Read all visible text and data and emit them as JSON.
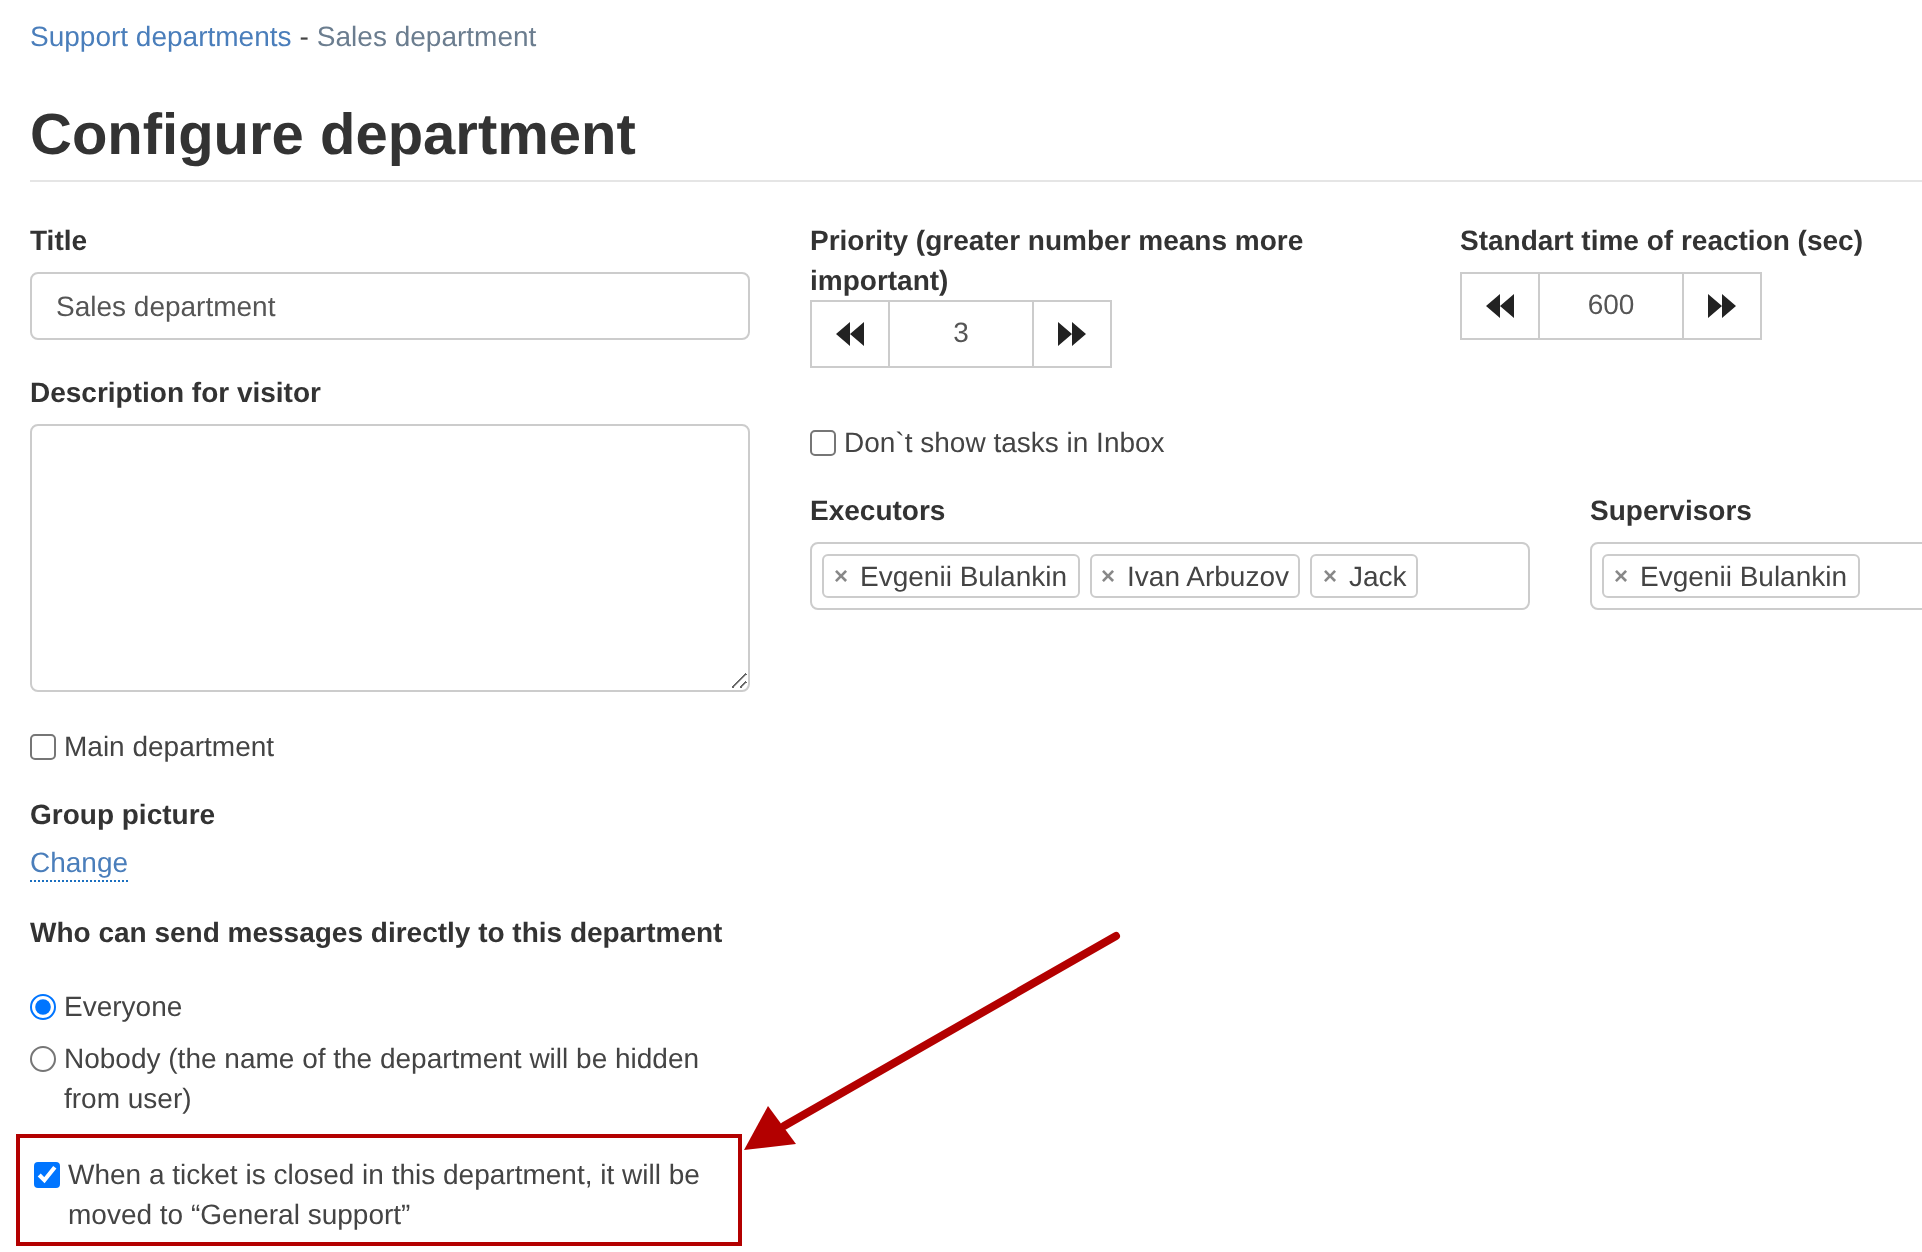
{
  "breadcrumb": [
    {
      "label": "Support departments",
      "kind": "link"
    },
    {
      "label": "-",
      "kind": "separator"
    },
    {
      "label": "Sales department",
      "kind": "current"
    }
  ],
  "heading": "Configure department",
  "title_field": {
    "label": "Title",
    "value": "Sales department"
  },
  "description_field": {
    "label": "Description for visitor"
  },
  "main_department": {
    "label": "Main department",
    "checked": false
  },
  "group_picture": {
    "label": "Group picture",
    "link": "Change"
  },
  "who_can_send": {
    "label": "Who can send messages directly to this department",
    "options": [
      {
        "label": "Everyone",
        "selected": true
      },
      {
        "label": "Nobody (the name of the department will be hidden from user)",
        "selected": false
      }
    ]
  },
  "move_on_close": {
    "label": "When a ticket is closed in this department, it will be moved to “General support”",
    "checked": true,
    "highlighted": true
  },
  "priority": {
    "label": "Priority (greater number means more important)",
    "value": "3"
  },
  "reaction_time": {
    "label": "Standart time of reaction (sec)",
    "value": "600"
  },
  "dont_show_inbox": {
    "label": "Don`t show tasks in Inbox",
    "checked": false
  },
  "executors": {
    "label": "Executors",
    "tags": [
      {
        "remove": "×",
        "name": "Evgenii Bulankin"
      },
      {
        "remove": "×",
        "name": "Ivan Arbuzov"
      },
      {
        "remove": "×",
        "name": "Jack"
      }
    ]
  },
  "supervisors": {
    "label": "Supervisors",
    "tags": [
      {
        "remove": "×",
        "name": "Evgenii Bulankin"
      }
    ]
  }
}
